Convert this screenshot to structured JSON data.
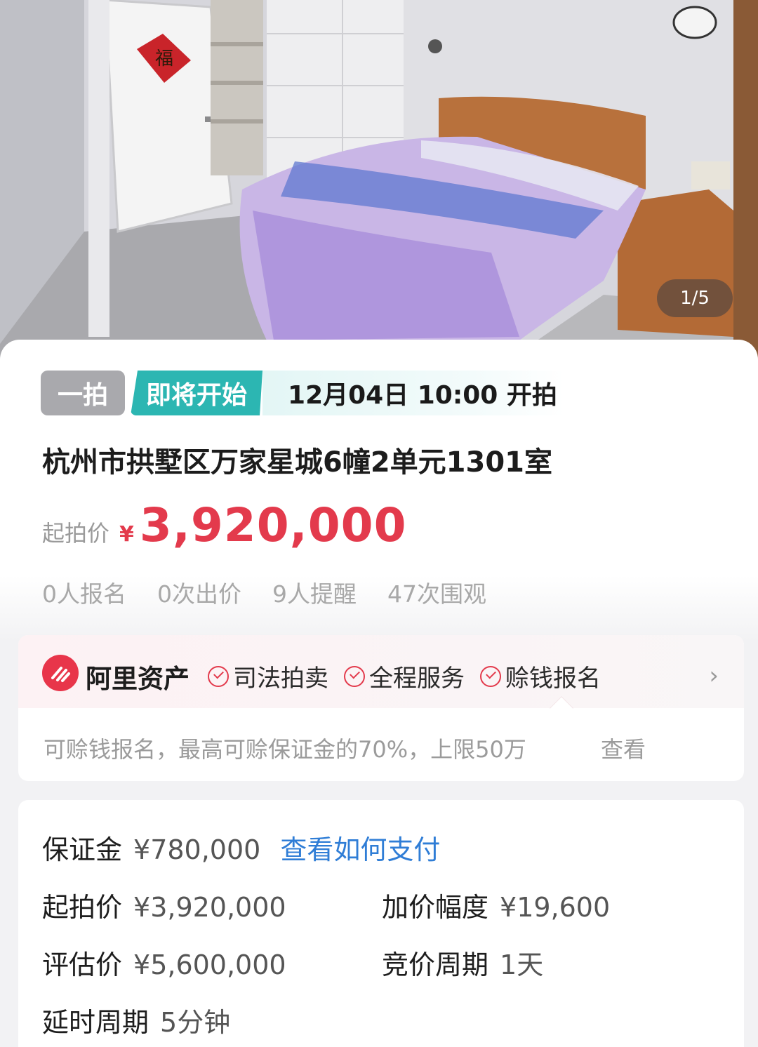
{
  "photo": {
    "counter": "1/5",
    "door_sign": "福"
  },
  "auction": {
    "round_tag": "一拍",
    "status_tag": "即将开始",
    "start_time": "12月04日 10:00 开拍",
    "title": "杭州市拱墅区万家星城6幢2单元1301室",
    "price_label": "起拍价",
    "currency": "¥",
    "price": "3,920,000",
    "stats": [
      "0人报名",
      "0次出价",
      "9人提醒",
      "47次围观"
    ]
  },
  "ali": {
    "brand": "阿里资产",
    "tags": [
      "司法拍卖",
      "全程服务",
      "赊钱报名"
    ],
    "info": "可赊钱报名，最高可赊保证金的70%，上限50万",
    "view_label": "查看"
  },
  "details": {
    "deposit_label": "保证金",
    "deposit_value": "¥780,000",
    "deposit_link": "查看如何支付",
    "start_price_label": "起拍价",
    "start_price_value": "¥3,920,000",
    "increment_label": "加价幅度",
    "increment_value": "¥19,600",
    "appraisal_label": "评估价",
    "appraisal_value": "¥5,600,000",
    "bid_cycle_label": "竞价周期",
    "bid_cycle_value": "1天",
    "extension_label": "延时周期",
    "extension_value": "5分钟"
  },
  "colors": {
    "price_red": "#e33a4c",
    "status_teal": "#2cb6b2",
    "link_blue": "#2f7dd6",
    "round_gray": "#a9a9ad"
  }
}
